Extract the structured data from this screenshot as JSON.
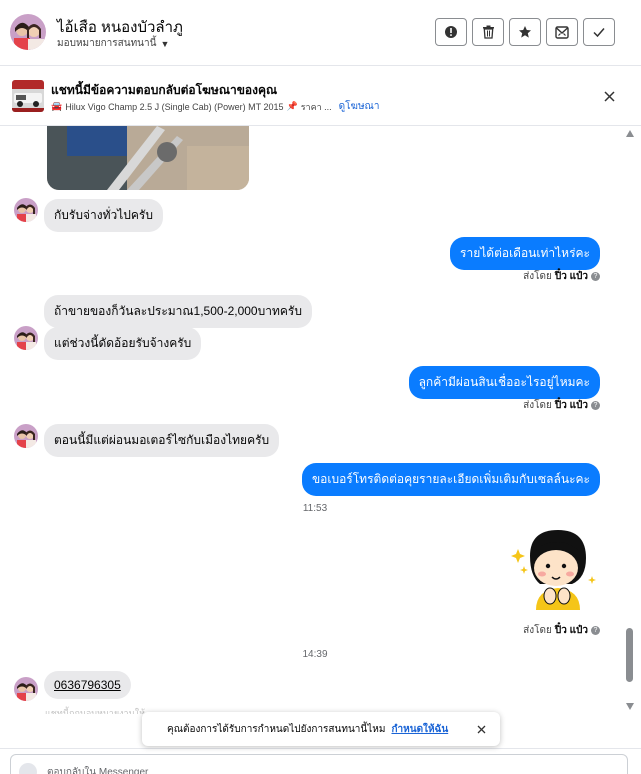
{
  "header": {
    "name": "ไอ้เสือ หนองบัวลำภู",
    "subtitle": "มอบหมายการสนทนานี้",
    "actions": [
      "report-icon",
      "trash-icon",
      "star-icon",
      "mark-unread-icon",
      "check-icon"
    ]
  },
  "ad": {
    "title": "แชทนี้มีข้อความตอบกลับต่อโฆษณาของคุณ",
    "car_emoji": "🚘",
    "description": "Hilux Vigo Champ 2.5 J (Single Cab) (Power) MT 2015",
    "pin": "📌",
    "price": "ราคา ...",
    "view_link": "ดูโฆษณา"
  },
  "messages": {
    "m1": "กับรับจ่างทั่วไปครับ",
    "m2": "รายได้ต่อเดือนเท่าไหร่คะ",
    "m3": "ถ้าขายของก็วันละประมาณ1,500-2,000บาทครับ",
    "m4": "แต่ช่วงนี้ดัดอ้อยรับจ้างครับ",
    "m5": "ลูกค้ามีผ่อนสินเชื่ออะไรอยู่ไหมคะ",
    "m6": "ตอนนี้มีแต่ผ่อนมอเตอร์ไซกับเมืองไทยครับ",
    "m7": "ขอเบอร์โทรติดต่อคุยรายละเอียดเพิ่มเติมกับเซลล์นะคะ",
    "m8": "0636796305",
    "faded": "แชทนี้ถูกมอบหมายงานให้"
  },
  "sent_by": {
    "prefix": "ส่งโดย",
    "name": "ปิ๋ว แป๋ว"
  },
  "timestamps": {
    "t1": "11:53",
    "t2": "14:39"
  },
  "notification": {
    "text": "คุณต้องการได้รับการกำหนดไปยังการสนทนานี้ไหม",
    "link": "กำหนดให้ฉัน"
  },
  "reply": {
    "placeholder": "ตอบกลับใน Messenger"
  },
  "colors": {
    "outgoing": "#0a7cff",
    "incoming": "#e9e9eb",
    "link": "#1a64d6"
  }
}
